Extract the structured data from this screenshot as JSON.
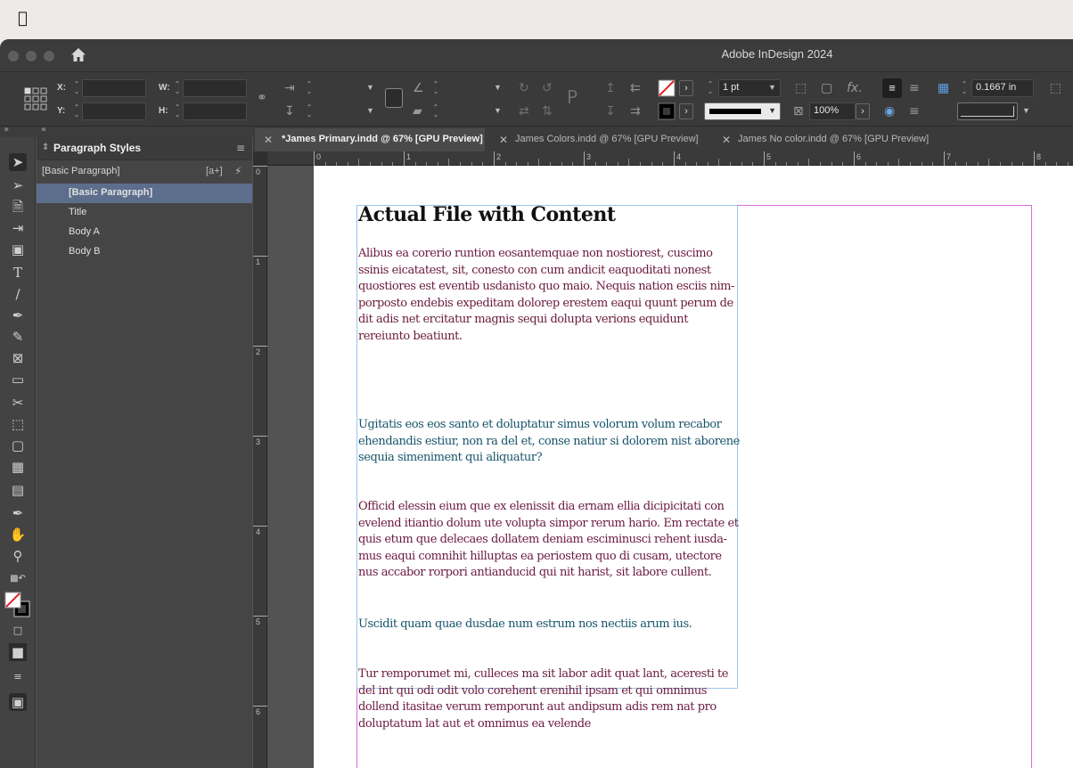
{
  "menubar": {
    "apple_icon": "apple-icon"
  },
  "window": {
    "title": "Adobe InDesign 2024"
  },
  "control": {
    "x_label": "X:",
    "y_label": "Y:",
    "w_label": "W:",
    "h_label": "H:",
    "stroke_weight": "1 pt",
    "scale": "100%",
    "offset": "0.1667 in"
  },
  "panel": {
    "title": "Paragraph Styles",
    "current_style": "[Basic Paragraph]",
    "new_style_badge": "[a+]",
    "styles": [
      "[Basic Paragraph]",
      "Title",
      "Body A",
      "Body B"
    ]
  },
  "tabs": [
    {
      "label": "*James Primary.indd @ 67% [GPU Preview]",
      "active": true
    },
    {
      "label": "James Colors.indd @ 67% [GPU Preview]",
      "active": false
    },
    {
      "label": "James No color.indd @ 67% [GPU Preview]",
      "active": false
    }
  ],
  "ruler": {
    "h": [
      "0",
      "1",
      "2",
      "3",
      "4",
      "5",
      "6",
      "7",
      "8"
    ],
    "v": [
      "0",
      "1",
      "2",
      "3",
      "4",
      "5",
      "6"
    ]
  },
  "document": {
    "title": "Actual File with Content",
    "colors": {
      "body_a": "#6b1a3e",
      "body_b": "#16546a"
    },
    "paragraphs": [
      {
        "style": "a",
        "text": "Alibus ea corerio runtion eosantemquae non nostiorest, cuscimo ssinis eicatatest, sit, conesto con cum andicit eaquoditati nonest quostiores est eventib usdanisto quo maio. Nequis nation esciis nim-porposto endebis expeditam dolorep erestem eaqui quunt perum de dit adis net ercitatur magnis sequi dolupta verions equidunt rereiunto beatiunt."
      },
      {
        "style": "b",
        "text": "Ugitatis eos eos santo et doluptatur simus volorum volum recabor ehendandis estiur, non ra del et, conse natiur si dolorem nist aborene sequia simeniment qui aliquatur?"
      },
      {
        "style": "a",
        "text": "Officid elessin eium que ex elenissit dia ernam ellia dicipicitati con evelend itiantio dolum ute volupta simpor rerum hario. Em rectate et quis etum que delecaes dollatem deniam esciminusci rehent iusda-mus eaqui comnihit hilluptas ea periostem quo di cusam, utectore nus accabor rorpori antianducid qui nit harist, sit labore cullent."
      },
      {
        "style": "b",
        "text": "Uscidit quam quae dusdae num estrum nos nectiis arum ius."
      },
      {
        "style": "a",
        "text": "Tur remporumet mi, culleces ma sit labor adit quat lant, aceresti te del int qui odi odit volo corehent erenihil ipsam et qui omnimus dollend itasitae verum remporunt aut andipsum adis rem nat pro doluptatum lat aut et omnimus ea velende"
      }
    ]
  }
}
